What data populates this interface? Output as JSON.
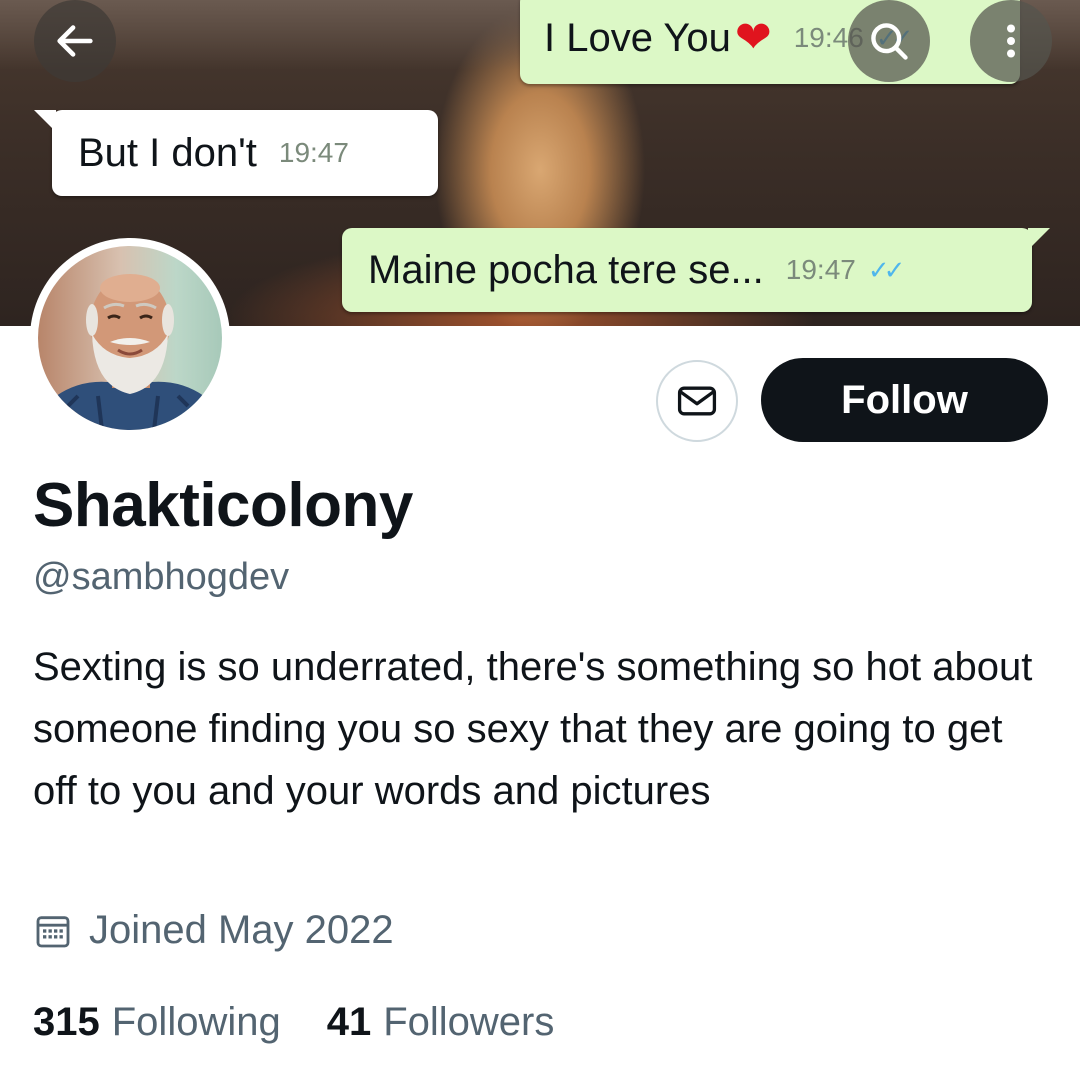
{
  "banner": {
    "messages": [
      {
        "text": "I Love You",
        "time": "19:46",
        "ticks": "✓✓",
        "direction": "out"
      },
      {
        "text": "But I don't",
        "time": "19:47",
        "direction": "in"
      },
      {
        "text": "Maine pocha tere se...",
        "time": "19:47",
        "ticks": "✓✓",
        "direction": "out"
      }
    ]
  },
  "nav": {
    "back_icon": "arrow-left-icon",
    "search_icon": "search-icon",
    "more_icon": "more-vertical-icon"
  },
  "profile": {
    "name": "Shakticolony",
    "handle": "@sambhogdev",
    "bio": "Sexting is so underrated, there's something so hot about someone finding you so sexy that they are going to get off to you and your words and pictures",
    "joined": "Joined May 2022",
    "following_count": "315",
    "following_label": "Following",
    "followers_count": "41",
    "followers_label": "Followers"
  },
  "actions": {
    "follow_label": "Follow",
    "message_icon": "envelope-icon"
  },
  "colors": {
    "primary_text": "#0f1419",
    "secondary_text": "#536471",
    "follow_bg": "#0f1419",
    "bubble_out": "#dcf8c6"
  }
}
